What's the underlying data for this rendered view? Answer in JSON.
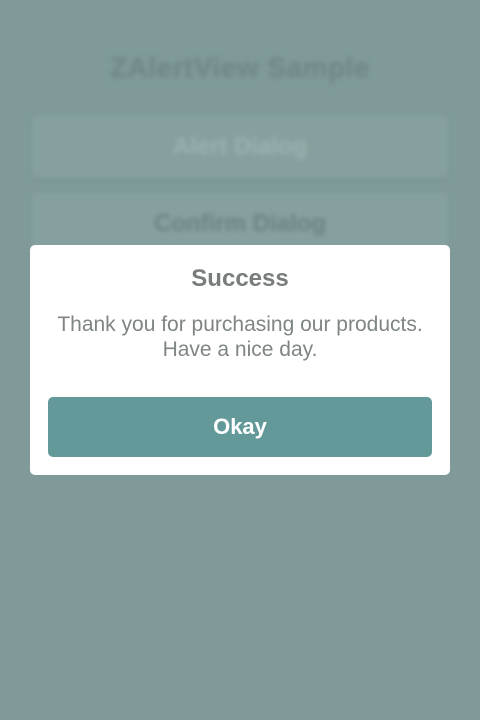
{
  "background_app": {
    "title": "ZAlertView Sample",
    "buttons": [
      {
        "label": "Alert Dialog"
      },
      {
        "label": "Confirm Dialog"
      }
    ]
  },
  "dialog": {
    "title": "Success",
    "message_lines": [
      "Thank you for purchasing our products.",
      "Have a nice day."
    ],
    "okay_label": "Okay"
  },
  "colors": {
    "overlay": "#7f9a99",
    "accent_button": "#649999",
    "dialog_background": "#ffffff"
  }
}
